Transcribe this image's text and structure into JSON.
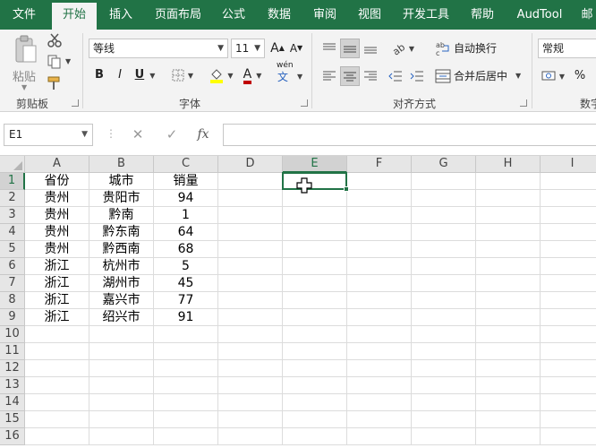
{
  "tabs": [
    "文件",
    "开始",
    "插入",
    "页面布局",
    "公式",
    "数据",
    "审阅",
    "视图",
    "开发工具",
    "帮助",
    "AudTool",
    "邮"
  ],
  "active_tab": "开始",
  "clipboard": {
    "paste_label": "粘贴",
    "group_label": "剪贴板"
  },
  "font": {
    "name": "等线",
    "size": "11",
    "grow_label": "A",
    "shrink_label": "A",
    "bold": "B",
    "italic": "I",
    "underline": "U",
    "pinyin_top": "wén",
    "pinyin_bottom": "文",
    "font_color_label": "A",
    "group_label": "字体"
  },
  "alignment": {
    "wrap_text": "自动换行",
    "merge_center": "合并后居中",
    "group_label": "对齐方式"
  },
  "number": {
    "format": "常规",
    "percent": "%",
    "group_label": "数字"
  },
  "formula_bar": {
    "name_box": "E1",
    "cancel": "✕",
    "enter": "✓",
    "fx": "fx",
    "value": ""
  },
  "colors": {
    "accent": "#217346",
    "fill_highlight": "#ffff00",
    "font_red": "#c00000"
  },
  "sheet": {
    "columns": [
      "A",
      "B",
      "C",
      "D",
      "E",
      "F",
      "G",
      "H",
      "I"
    ],
    "selected_column": "E",
    "selected_row": "1",
    "rows": [
      {
        "n": "1",
        "a": "省份",
        "b": "城市",
        "c": "销量"
      },
      {
        "n": "2",
        "a": "贵州",
        "b": "贵阳市",
        "c": "94"
      },
      {
        "n": "3",
        "a": "贵州",
        "b": "黔南",
        "c": "1"
      },
      {
        "n": "4",
        "a": "贵州",
        "b": "黔东南",
        "c": "64"
      },
      {
        "n": "5",
        "a": "贵州",
        "b": "黔西南",
        "c": "68"
      },
      {
        "n": "6",
        "a": "浙江",
        "b": "杭州市",
        "c": "5"
      },
      {
        "n": "7",
        "a": "浙江",
        "b": "湖州市",
        "c": "45"
      },
      {
        "n": "8",
        "a": "浙江",
        "b": "嘉兴市",
        "c": "77"
      },
      {
        "n": "9",
        "a": "浙江",
        "b": "绍兴市",
        "c": "91"
      },
      {
        "n": "10",
        "a": "",
        "b": "",
        "c": ""
      },
      {
        "n": "11",
        "a": "",
        "b": "",
        "c": ""
      },
      {
        "n": "12",
        "a": "",
        "b": "",
        "c": ""
      },
      {
        "n": "13",
        "a": "",
        "b": "",
        "c": ""
      },
      {
        "n": "14",
        "a": "",
        "b": "",
        "c": ""
      },
      {
        "n": "15",
        "a": "",
        "b": "",
        "c": ""
      },
      {
        "n": "16",
        "a": "",
        "b": "",
        "c": ""
      }
    ]
  }
}
